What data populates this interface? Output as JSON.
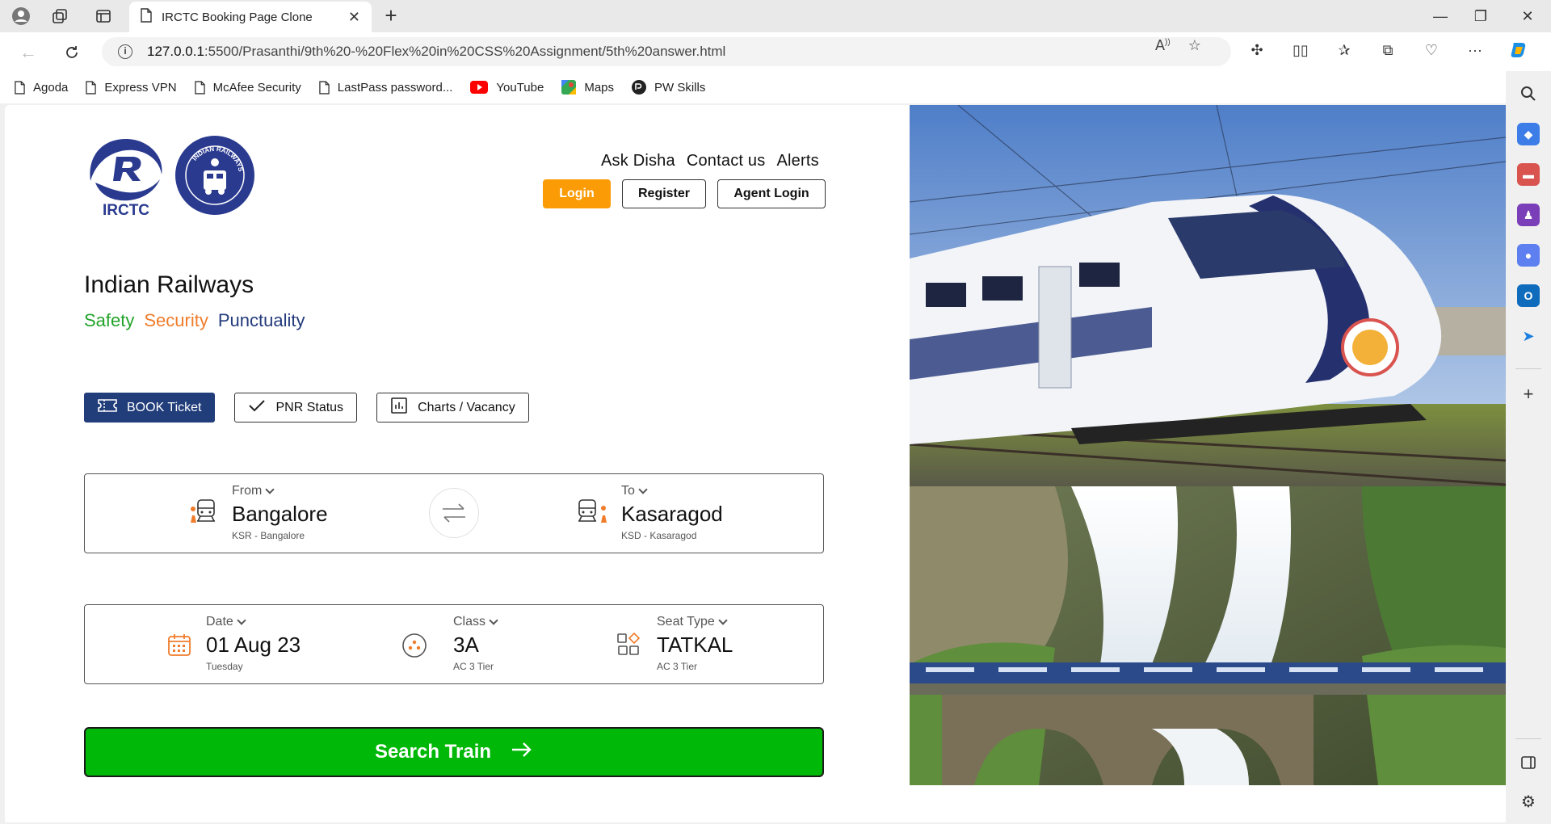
{
  "browser": {
    "tab_title": "IRCTC Booking Page Clone",
    "url_host": "127.0.0.1",
    "url_path": ":5500/Prasanthi/9th%20-%20Flex%20in%20CSS%20Assignment/5th%20answer.html",
    "bookmarks": [
      {
        "label": "Agoda",
        "icon": "page-icon"
      },
      {
        "label": "Express VPN",
        "icon": "page-icon"
      },
      {
        "label": "McAfee Security",
        "icon": "page-icon"
      },
      {
        "label": "LastPass password...",
        "icon": "page-icon"
      },
      {
        "label": "YouTube",
        "icon": "youtube-icon"
      },
      {
        "label": "Maps",
        "icon": "maps-icon"
      },
      {
        "label": "PW Skills",
        "icon": "pw-icon"
      }
    ]
  },
  "header": {
    "links": [
      "Ask Disha",
      "Contact us",
      "Alerts"
    ],
    "login": "Login",
    "register": "Register",
    "agent_login": "Agent Login",
    "logo_text": "IRCTC",
    "seal_text": "INDIAN RAILWAYS"
  },
  "hero": {
    "title": "Indian Railways",
    "safety": "Safety",
    "security": "Security",
    "punctuality": "Punctuality"
  },
  "tabs": {
    "book": "BOOK Ticket",
    "pnr": "PNR Status",
    "charts": "Charts / Vacancy"
  },
  "journey": {
    "from_label": "From",
    "from_value": "Bangalore",
    "from_sub": "KSR - Bangalore",
    "to_label": "To",
    "to_value": "Kasaragod",
    "to_sub": "KSD - Kasaragod"
  },
  "details": {
    "date_label": "Date",
    "date_value": "01 Aug 23",
    "date_sub": "Tuesday",
    "class_label": "Class",
    "class_value": "3A",
    "class_sub": "AC 3 Tier",
    "seat_label": "Seat Type",
    "seat_value": "TATKAL",
    "seat_sub": "AC 3 Tier"
  },
  "search_button": "Search Train",
  "colors": {
    "login_orange": "#fb9b06",
    "navy": "#213d7a",
    "safety_green": "#22a32a",
    "security_orange": "#f07c2b",
    "search_green": "#00b807"
  }
}
